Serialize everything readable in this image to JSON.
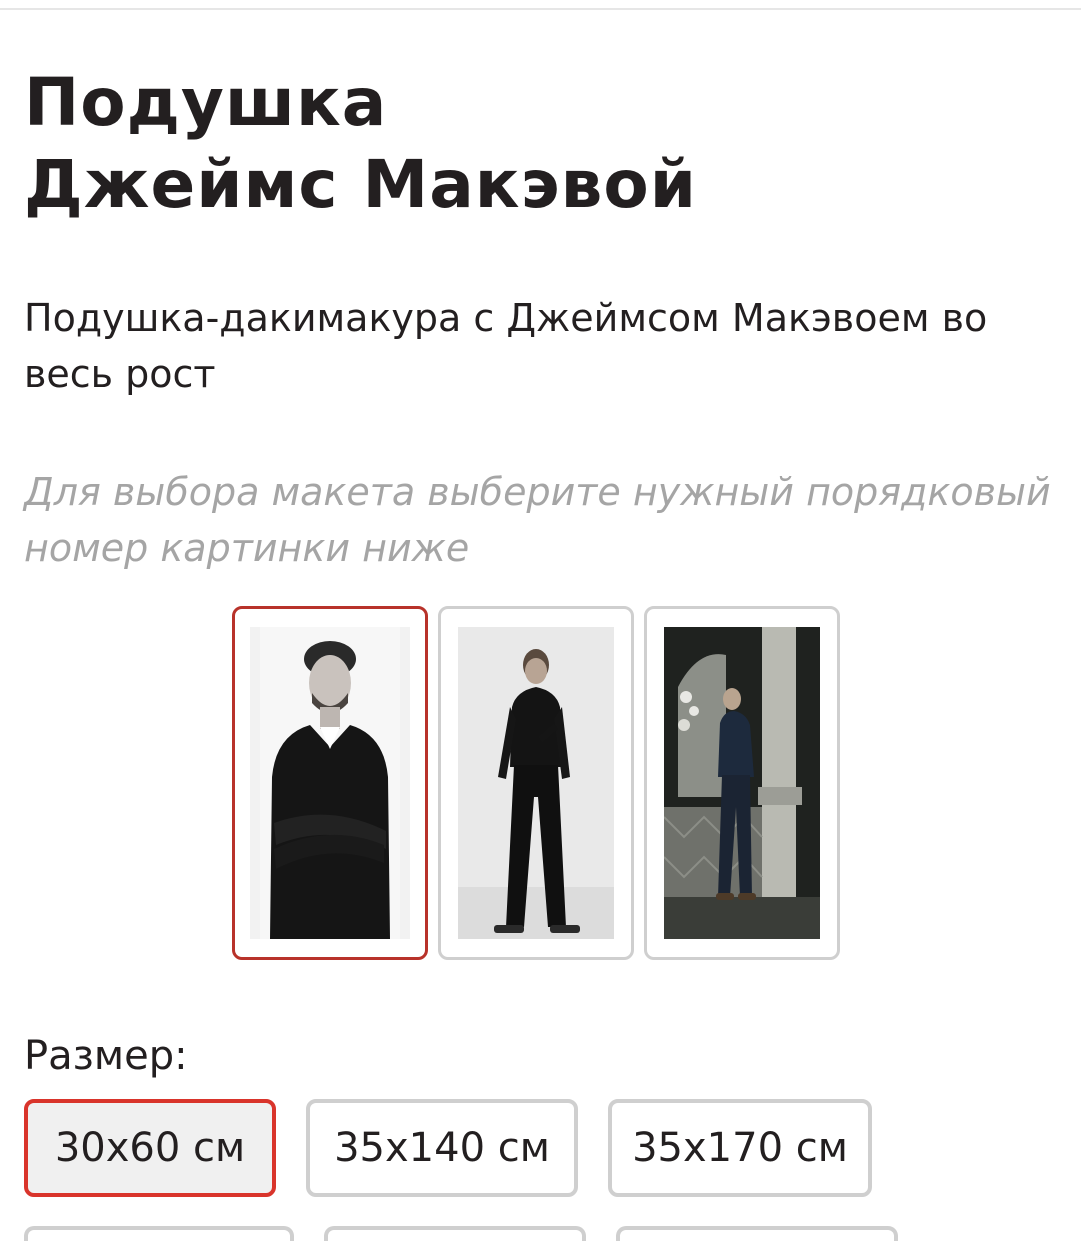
{
  "product": {
    "title_line1": "Подушка",
    "title_line2": "Джеймс Макэвой",
    "subtitle": "Подушка-дакимакура с Джеймсом Макэвоем во весь рост",
    "hint": "Для выбора макета выберите нужный порядковый номер картинки ниже"
  },
  "layouts": [
    {
      "name": "photo-1",
      "selected": true
    },
    {
      "name": "photo-2",
      "selected": false
    },
    {
      "name": "photo-3",
      "selected": false
    }
  ],
  "size": {
    "label": "Размер:",
    "options": [
      {
        "label": "30x60 см",
        "selected": true
      },
      {
        "label": "35x140 см",
        "selected": false
      },
      {
        "label": "35x170 см",
        "selected": false
      }
    ]
  },
  "colors": {
    "accent_selected": "#d9342b",
    "text": "#231f20",
    "hint": "#a5a5a5",
    "border": "#cfcfcf"
  }
}
